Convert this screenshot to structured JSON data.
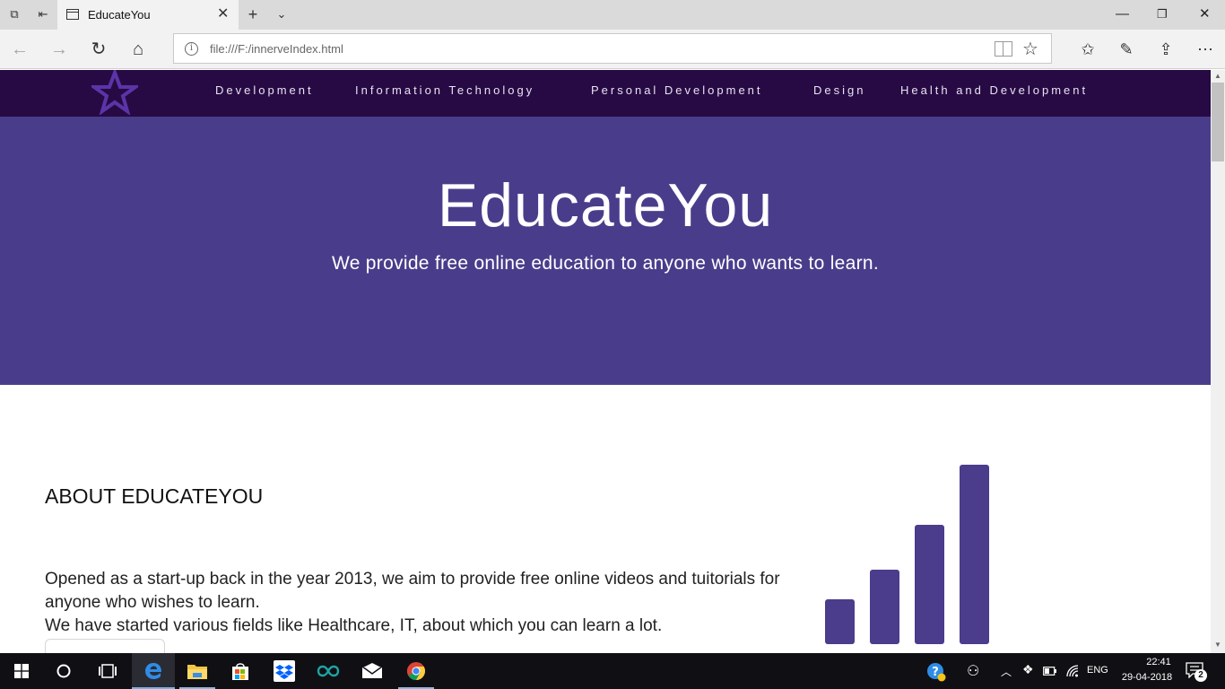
{
  "browser": {
    "tab_title": "EducateYou",
    "address": "file:///F:/innerveIndex.html"
  },
  "site": {
    "nav": [
      "Development",
      "Information Technology",
      "Personal Development",
      "Design",
      "Health and Development"
    ],
    "hero_title": "EducateYou",
    "hero_subtitle": "We provide free online education to anyone who wants to learn.",
    "about_heading": "ABOUT EDUCATEYOU",
    "about_line1": "Opened as a start-up back in the year 2013, we aim to provide free online videos and tuitorials for anyone who wishes to learn.",
    "about_line2": "We have started various fields like Healthcare, IT, about which you can learn a lot.",
    "colors": {
      "header": "#270a43",
      "hero": "#493d8b",
      "accent": "#4b3c8c"
    }
  },
  "taskbar": {
    "lang": "ENG",
    "time": "22:41",
    "date": "29-04-2018",
    "notifications": "2"
  },
  "icons": [
    "back-arrow-icon",
    "forward-arrow-icon",
    "refresh-icon",
    "home-icon",
    "info-icon",
    "reading-view-icon",
    "favorite-star-icon",
    "favorites-hub-icon",
    "pen-icon",
    "share-icon",
    "more-icon",
    "windows-start-icon",
    "cortana-icon",
    "task-view-icon",
    "edge-icon",
    "file-explorer-icon",
    "store-icon",
    "dropbox-icon",
    "arduino-icon",
    "mail-icon",
    "chrome-icon",
    "star-logo-icon",
    "bar-chart-icon"
  ]
}
